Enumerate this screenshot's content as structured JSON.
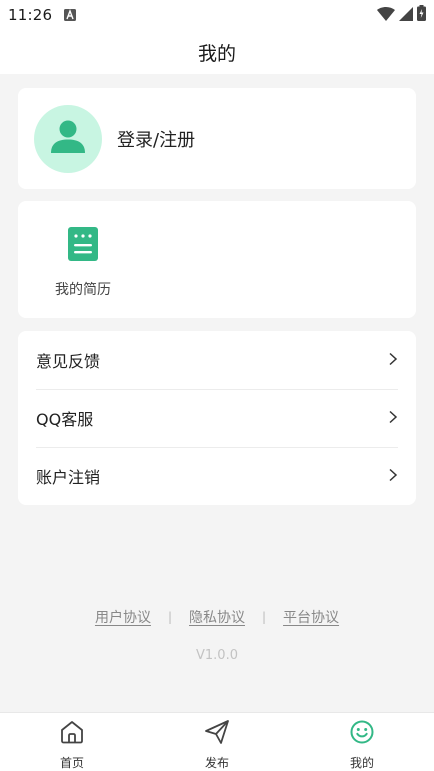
{
  "status_bar": {
    "time": "11:26",
    "icons": [
      "notification-a-icon",
      "wifi-icon",
      "signal-icon",
      "battery-icon"
    ]
  },
  "header": {
    "title": "我的"
  },
  "profile": {
    "login_label": "登录/注册",
    "avatar_icon": "user-icon",
    "avatar_bg": "#c8f5e2",
    "avatar_fg": "#33b886"
  },
  "quick_entries": [
    {
      "label": "我的简历",
      "icon": "resume-icon"
    }
  ],
  "menu": {
    "items": [
      {
        "label": "意见反馈"
      },
      {
        "label": "QQ客服"
      },
      {
        "label": "账户注销"
      }
    ]
  },
  "footer": {
    "links": [
      "用户协议",
      "隐私协议",
      "平台协议"
    ],
    "separator": "|",
    "version": "V1.0.0"
  },
  "tabbar": {
    "items": [
      {
        "label": "首页",
        "icon": "home-icon"
      },
      {
        "label": "发布",
        "icon": "send-icon"
      },
      {
        "label": "我的",
        "icon": "smile-icon"
      }
    ],
    "active_index": 2,
    "accent": "#33b886"
  }
}
